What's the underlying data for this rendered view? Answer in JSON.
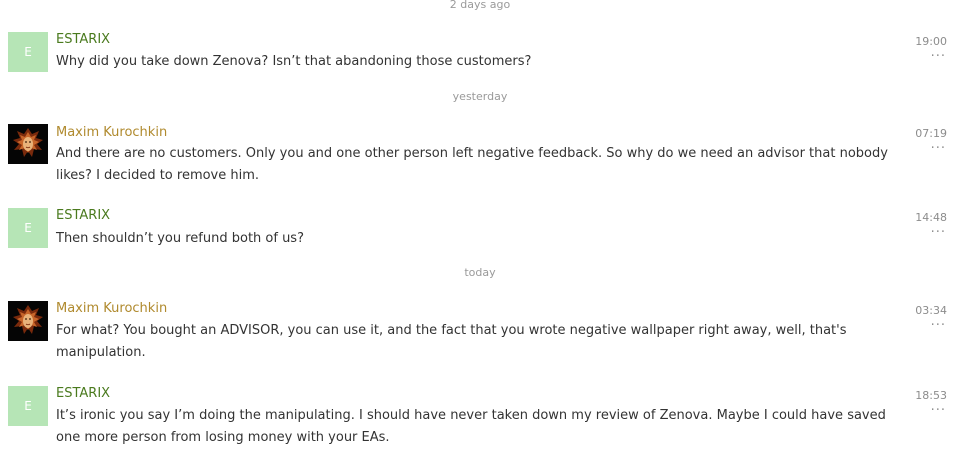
{
  "dividers": [
    "2 days ago",
    "yesterday",
    "today"
  ],
  "colors": {
    "estarix_name": "#4a7a1e",
    "maxim_name": "#b08a2e",
    "letter_avatar_bg": "#b6e5b6",
    "timestamp": "#8c8c8c",
    "divider": "#9a9a9a"
  },
  "messages": [
    {
      "author": "ESTARIX",
      "avatar_letter": "E",
      "text": "Why did you take down Zenova? Isn’t that abandoning those customers?",
      "time": "19:00",
      "more": "···"
    },
    {
      "author": "Maxim Kurochkin",
      "avatar_letter": "",
      "text": "And there are no customers. Only you and one other person left negative feedback. So why do we need an advisor that nobody likes? I decided to remove him.",
      "time": "07:19",
      "more": "···"
    },
    {
      "author": "ESTARIX",
      "avatar_letter": "E",
      "text": "Then shouldn’t you refund both of us?",
      "time": "14:48",
      "more": "···"
    },
    {
      "author": "Maxim Kurochkin",
      "avatar_letter": "",
      "text": "For what? You bought an ADVISOR, you can use it, and the fact that you wrote negative wallpaper right away, well, that's manipulation.",
      "time": "03:34",
      "more": "···"
    },
    {
      "author": "ESTARIX",
      "avatar_letter": "E",
      "text": "It’s ironic you say I’m doing the manipulating. I should have never taken down my review of Zenova. Maybe I could have saved one more person from losing money with your EAs.",
      "time": "18:53",
      "more": "···"
    }
  ]
}
